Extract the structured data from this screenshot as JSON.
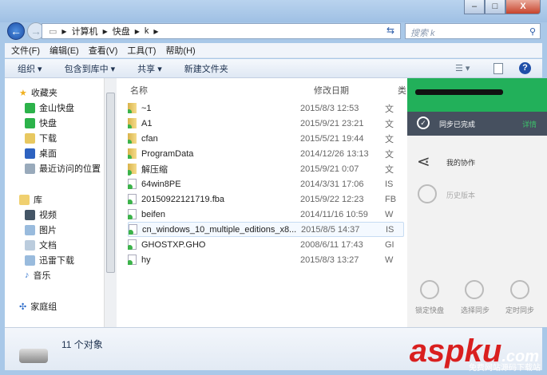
{
  "window": {
    "minimize": "–",
    "maximize": "□",
    "close": "X"
  },
  "address": {
    "crumbs": [
      "计算机",
      "快盘",
      "k"
    ]
  },
  "search": {
    "placeholder": "搜索 k"
  },
  "menu": [
    "文件(F)",
    "编辑(E)",
    "查看(V)",
    "工具(T)",
    "帮助(H)"
  ],
  "toolbar": [
    "组织 ▾",
    "包含到库中 ▾",
    "共享 ▾",
    "新建文件夹"
  ],
  "nav": {
    "favorites": {
      "label": "收藏夹",
      "items": [
        "金山快盘",
        "快盘",
        "下载",
        "桌面",
        "最近访问的位置"
      ]
    },
    "library": {
      "label": "库",
      "items": [
        "视频",
        "图片",
        "文档",
        "迅雷下载",
        "音乐"
      ]
    },
    "homegroup": "家庭组"
  },
  "columns": {
    "name": "名称",
    "date": "修改日期",
    "type": "类"
  },
  "files": [
    {
      "name": "~1",
      "date": "2015/8/3 12:53",
      "type": "文",
      "kind": "folder"
    },
    {
      "name": "A1",
      "date": "2015/9/21 23:21",
      "type": "文",
      "kind": "folder"
    },
    {
      "name": "cfan",
      "date": "2015/5/21 19:44",
      "type": "文",
      "kind": "folder"
    },
    {
      "name": "ProgramData",
      "date": "2014/12/26 13:13",
      "type": "文",
      "kind": "folder"
    },
    {
      "name": "解压缩",
      "date": "2015/9/21 0:07",
      "type": "文",
      "kind": "folder"
    },
    {
      "name": "64win8PE",
      "date": "2014/3/31 17:06",
      "type": "IS",
      "kind": "file"
    },
    {
      "name": "20150922121719.fba",
      "date": "2015/9/22 12:23",
      "type": "FB",
      "kind": "file"
    },
    {
      "name": "beifen",
      "date": "2014/11/16 10:59",
      "type": "W",
      "kind": "file"
    },
    {
      "name": "cn_windows_10_multiple_editions_x8...",
      "date": "2015/8/5 14:37",
      "type": "IS",
      "kind": "file"
    },
    {
      "name": "GHOSTXP.GHO",
      "date": "2008/6/11 17:43",
      "type": "GI",
      "kind": "file"
    },
    {
      "name": "hy",
      "date": "2015/8/3 13:27",
      "type": "W",
      "kind": "file"
    }
  ],
  "panel": {
    "sync_status": "同步已完成",
    "details": "详情",
    "collab": "我的协作",
    "history": "历史版本",
    "actions": [
      "锁定快盘",
      "选择同步",
      "定时同步"
    ]
  },
  "status": {
    "count": "11 个对象"
  },
  "watermark": {
    "logo": "aspku",
    "domain": ".com",
    "tagline": "免费网站源码下载站"
  }
}
